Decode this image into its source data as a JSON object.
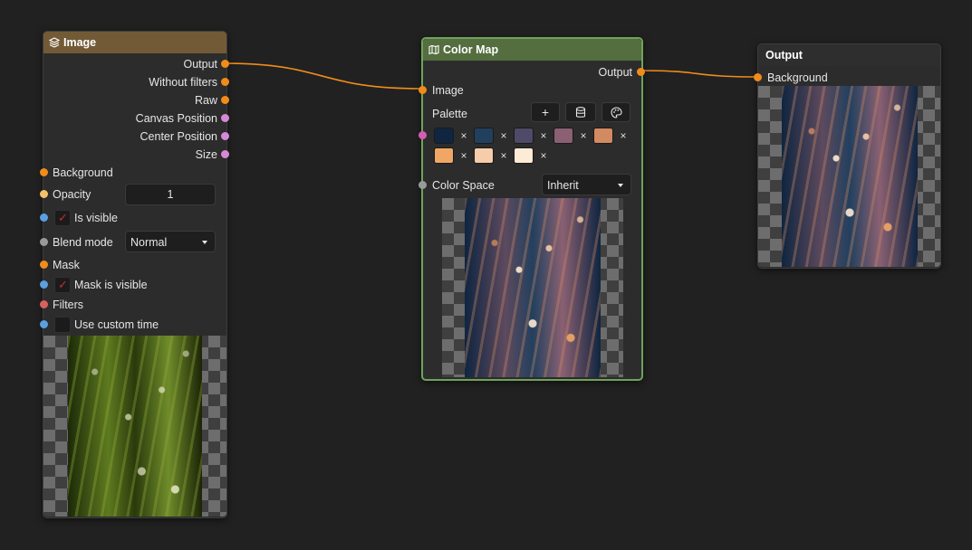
{
  "nodes": {
    "image": {
      "title": "Image",
      "outputs": [
        "Output",
        "Without filters",
        "Raw",
        "Canvas Position",
        "Center Position",
        "Size"
      ],
      "background_label": "Background",
      "opacity_label": "Opacity",
      "opacity_value": "1",
      "is_visible_label": "Is visible",
      "blend_mode_label": "Blend mode",
      "blend_mode_value": "Normal",
      "mask_label": "Mask",
      "mask_visible_label": "Mask is visible",
      "filters_label": "Filters",
      "custom_time_label": "Use custom time"
    },
    "color_map": {
      "title": "Color Map",
      "output_label": "Output",
      "image_label": "Image",
      "palette_label": "Palette",
      "palette_buttons": [
        "+",
        "database-icon",
        "palette-icon"
      ],
      "swatches": [
        "#0f2540",
        "#22405e",
        "#4f4a68",
        "#8a6072",
        "#d28a60",
        "#f0a765",
        "#f6ccaa",
        "#fcebd6"
      ],
      "remove_glyph": "×",
      "color_space_label": "Color Space",
      "color_space_value": "Inherit"
    },
    "output": {
      "title": "Output",
      "background_label": "Background"
    }
  },
  "colors": {
    "image_header": "#725a37",
    "color_map_header": "#546e3f",
    "output_header": "#2e2e2e",
    "wire": "#f08c1a",
    "selected_border": "#6fa35a"
  }
}
